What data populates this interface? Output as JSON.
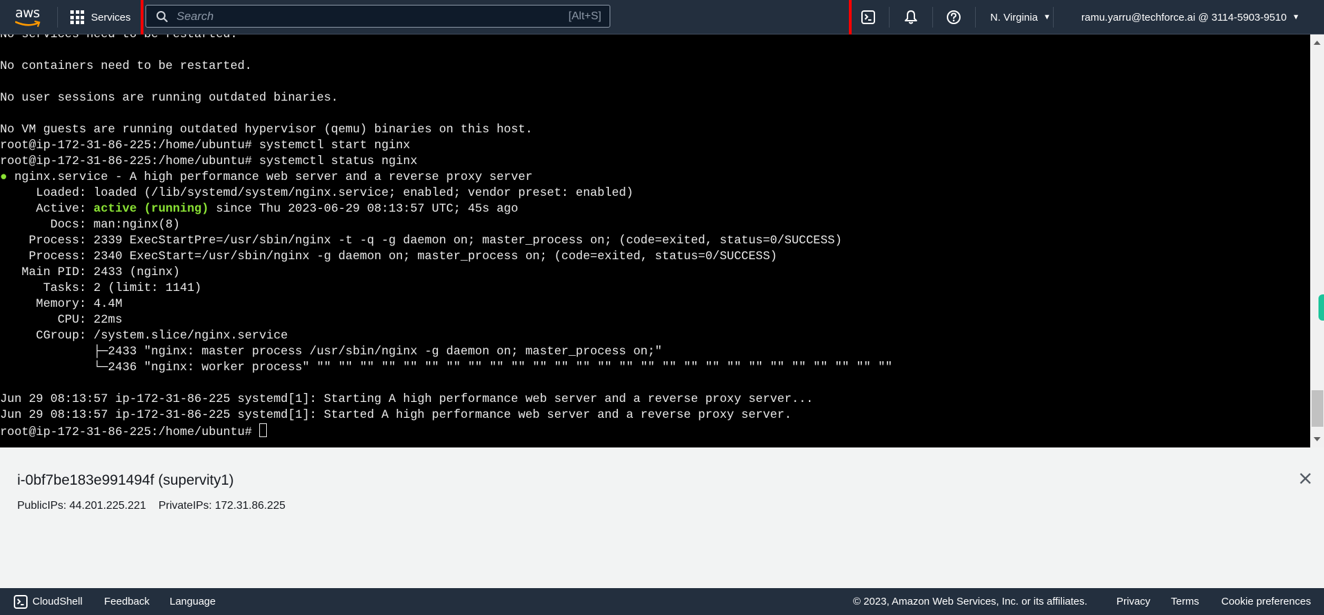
{
  "topnav": {
    "logo_text": "aws",
    "services_label": "Services",
    "search": {
      "placeholder": "Search",
      "value": "",
      "shortcut": "[Alt+S]"
    },
    "icons": [
      "cloudshell-icon",
      "notifications-bell-icon",
      "help-icon"
    ],
    "region": "N. Virginia",
    "account": "ramu.yarru@techforce.ai @ 3114-5903-9510"
  },
  "terminal": {
    "lines": [
      {
        "text": "No services need to be restarted."
      },
      {
        "text": ""
      },
      {
        "text": "No containers need to be restarted."
      },
      {
        "text": ""
      },
      {
        "text": "No user sessions are running outdated binaries."
      },
      {
        "text": ""
      },
      {
        "text": "No VM guests are running outdated hypervisor (qemu) binaries on this host."
      },
      {
        "text": "root@ip-172-31-86-225:/home/ubuntu# systemctl start nginx"
      },
      {
        "text": "root@ip-172-31-86-225:/home/ubuntu# systemctl status nginx"
      },
      {
        "bullet": "●",
        "text": " nginx.service - A high performance web server and a reverse proxy server"
      },
      {
        "text": "     Loaded: loaded (/lib/systemd/system/nginx.service; enabled; vendor preset: enabled)"
      },
      {
        "prefix": "     Active: ",
        "highlight": "active (running)",
        "text": " since Thu 2023-06-29 08:13:57 UTC; 45s ago"
      },
      {
        "text": "       Docs: man:nginx(8)"
      },
      {
        "text": "    Process: 2339 ExecStartPre=/usr/sbin/nginx -t -q -g daemon on; master_process on; (code=exited, status=0/SUCCESS)"
      },
      {
        "text": "    Process: 2340 ExecStart=/usr/sbin/nginx -g daemon on; master_process on; (code=exited, status=0/SUCCESS)"
      },
      {
        "text": "   Main PID: 2433 (nginx)"
      },
      {
        "text": "      Tasks: 2 (limit: 1141)"
      },
      {
        "text": "     Memory: 4.4M"
      },
      {
        "text": "        CPU: 22ms"
      },
      {
        "text": "     CGroup: /system.slice/nginx.service"
      },
      {
        "text": "             ├─2433 \"nginx: master process /usr/sbin/nginx -g daemon on; master_process on;\""
      },
      {
        "text": "             └─2436 \"nginx: worker process\" \"\" \"\" \"\" \"\" \"\" \"\" \"\" \"\" \"\" \"\" \"\" \"\" \"\" \"\" \"\" \"\" \"\" \"\" \"\" \"\" \"\" \"\" \"\" \"\" \"\" \"\" \"\""
      },
      {
        "text": ""
      },
      {
        "text": "Jun 29 08:13:57 ip-172-31-86-225 systemd[1]: Starting A high performance web server and a reverse proxy server..."
      },
      {
        "text": "Jun 29 08:13:57 ip-172-31-86-225 systemd[1]: Started A high performance web server and a reverse proxy server."
      },
      {
        "text": "root@ip-172-31-86-225:/home/ubuntu# ",
        "cursor": true
      }
    ],
    "scroll_position": 0.93
  },
  "instance": {
    "title": "i-0bf7be183e991494f (supervity1)",
    "public_ips": "PublicIPs: 44.201.225.221",
    "private_ips": "PrivateIPs: 172.31.86.225"
  },
  "footer": {
    "cloudshell": "CloudShell",
    "feedback": "Feedback",
    "language": "Language",
    "copyright": "© 2023, Amazon Web Services, Inc. or its affiliates.",
    "privacy": "Privacy",
    "terms": "Terms",
    "cookie": "Cookie preferences"
  },
  "colors": {
    "nav_bg": "#232f3e",
    "terminal_bg": "#000000",
    "terminal_fg": "#eaeaea",
    "active_green": "#8ae234",
    "highlight_red": "#ff0000",
    "side_tab": "#1cc49a"
  }
}
